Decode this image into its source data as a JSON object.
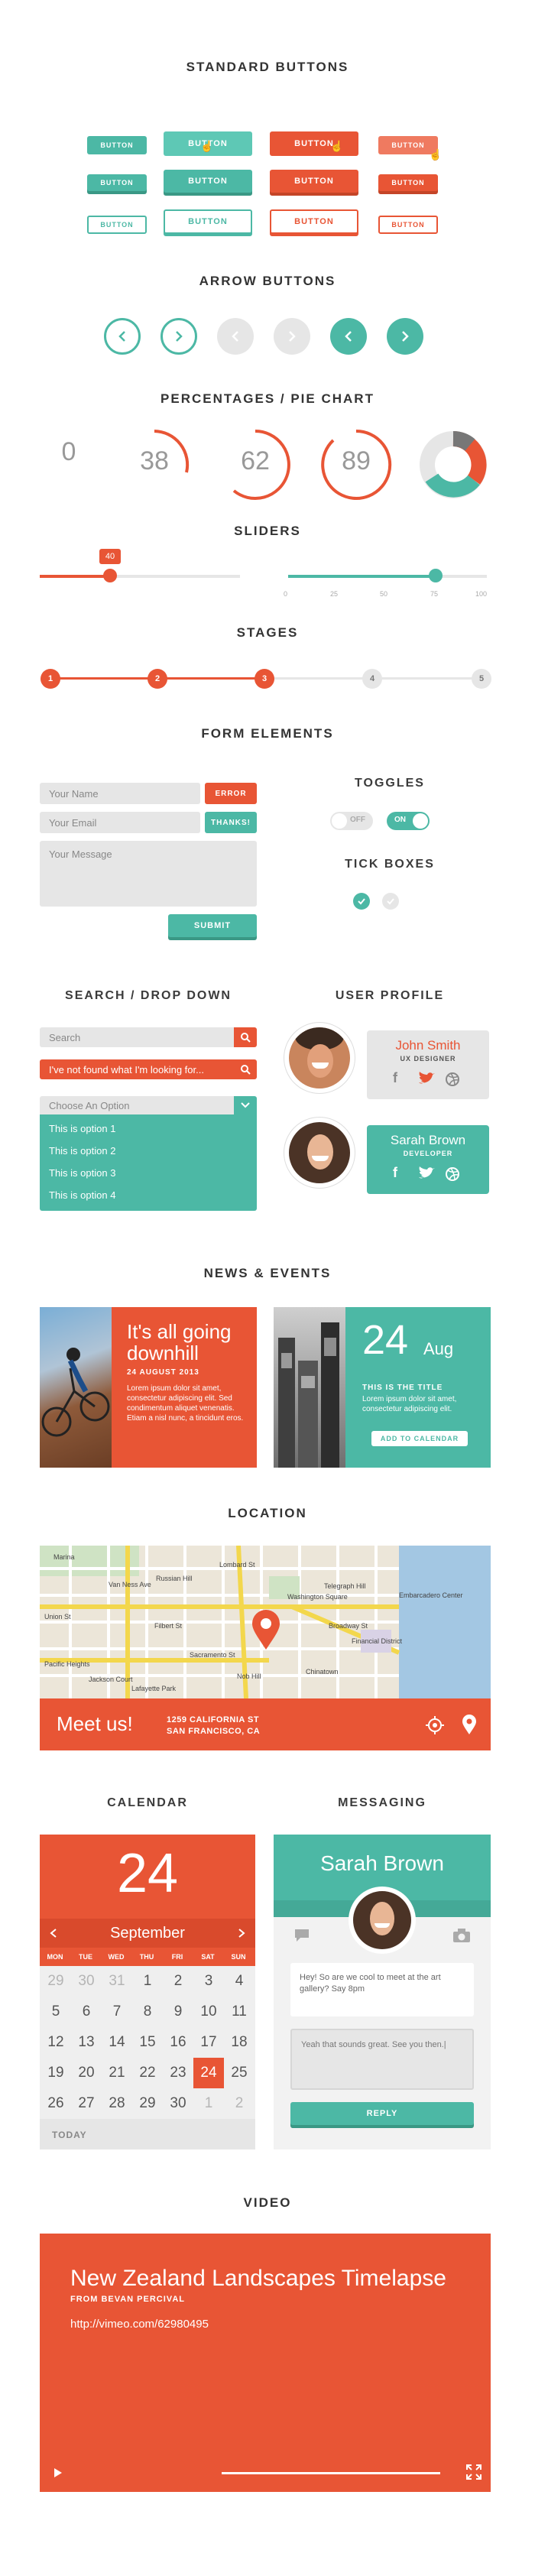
{
  "colors": {
    "teal": "#4cb8a5",
    "red": "#e85535",
    "grey": "#e6e6e6"
  },
  "sections": {
    "standard_buttons": "STANDARD BUTTONS",
    "arrow_buttons": "ARROW BUTTONS",
    "percentages": "PERCENTAGES / PIE CHART",
    "sliders": "SLIDERS",
    "stages": "STAGES",
    "form": "FORM ELEMENTS",
    "search": "SEARCH / DROP DOWN",
    "profile": "USER PROFILE",
    "news": "NEWS & EVENTS",
    "location": "LOCATION",
    "calendar": "CALENDAR",
    "messaging": "MESSAGING",
    "video": "VIDEO"
  },
  "buttons": {
    "label": "BUTTON"
  },
  "percentages": {
    "values": [
      "0",
      "38",
      "62",
      "89"
    ],
    "pie": [
      {
        "color": "#4cb8a5",
        "fraction": 0.45
      },
      {
        "color": "#e85535",
        "fraction": 0.2
      },
      {
        "color": "#777777",
        "fraction": 0.1
      },
      {
        "color": "#e6e6e6",
        "fraction": 0.25
      }
    ]
  },
  "sliders": {
    "value_badge": "40",
    "value_fraction": 0.33,
    "range_fraction": 0.75,
    "ticks": [
      "0",
      "25",
      "50",
      "75",
      "100"
    ]
  },
  "stages": {
    "labels": [
      "1",
      "2",
      "3",
      "4",
      "5"
    ],
    "current": 3
  },
  "form": {
    "name_placeholder": "Your Name",
    "email_placeholder": "Your Email",
    "message_placeholder": "Your Message",
    "error_label": "ERROR",
    "thanks_label": "THANKS!",
    "submit_label": "SUBMIT",
    "toggles_title": "TOGGLES",
    "toggle_off": "OFF",
    "toggle_on": "ON",
    "tick_title": "TICK BOXES"
  },
  "search": {
    "placeholder": "Search",
    "not_found": "I've not found what I'm looking for...",
    "dropdown_label": "Choose An Option",
    "options": [
      "This is option 1",
      "This is option 2",
      "This is option 3",
      "This is option 4"
    ]
  },
  "profiles": [
    {
      "name": "John Smith",
      "role": "UX DESIGNER"
    },
    {
      "name": "Sarah Brown",
      "role": "DEVELOPER"
    }
  ],
  "news": {
    "title_line1": "It's all going",
    "title_line2": "downhill",
    "date": "24 AUGUST 2013",
    "body": "Lorem ipsum dolor sit amet, consectetur adipiscing elit. Sed condimentum aliquet venenatis. Etiam a nisl nunc, a tincidunt eros."
  },
  "event": {
    "day": "24",
    "month": "Aug",
    "title": "THIS IS THE TITLE",
    "body": "Lorem ipsum dolor sit amet, consectetur adipiscing elit.",
    "cta": "ADD TO CALENDAR"
  },
  "location": {
    "meet": "Meet us!",
    "address1": "1259 CALIFORNIA ST",
    "address2": "SAN FRANCISCO, CA",
    "map_labels": [
      "Marina",
      "Russian Hill",
      "Lombard St",
      "Washington Square",
      "Telegraph Hill",
      "Broadway St",
      "Financial District",
      "Chinatown",
      "Nob Hill",
      "Jackson Court",
      "Lafayette Park",
      "Pacific Heights",
      "Union St",
      "Filbert St",
      "Sacramento St",
      "Van Ness Ave",
      "Embarcadero Center"
    ]
  },
  "calendar": {
    "day": "24",
    "month": "September",
    "weekdays": [
      "MON",
      "TUE",
      "WED",
      "THU",
      "FRI",
      "SAT",
      "SUN"
    ],
    "days": [
      "29",
      "30",
      "31",
      "1",
      "2",
      "3",
      "4",
      "5",
      "6",
      "7",
      "8",
      "9",
      "10",
      "11",
      "12",
      "13",
      "14",
      "15",
      "16",
      "17",
      "18",
      "19",
      "20",
      "21",
      "22",
      "23",
      "24",
      "25",
      "26",
      "27",
      "28",
      "29",
      "30",
      "1",
      "2"
    ],
    "dim_indices": [
      0,
      1,
      2,
      33,
      34
    ],
    "selected_index": 26,
    "today": "TODAY"
  },
  "messaging": {
    "name": "Sarah Brown",
    "received": "Hey! So are we cool to meet at the art gallery? Say 8pm",
    "reply_text": "Yeah that sounds great. See you then.|",
    "reply_label": "REPLY"
  },
  "video": {
    "title": "New Zealand Landscapes Timelapse",
    "author": "FROM BEVAN PERCIVAL",
    "url": "http://vimeo.com/62980495"
  }
}
